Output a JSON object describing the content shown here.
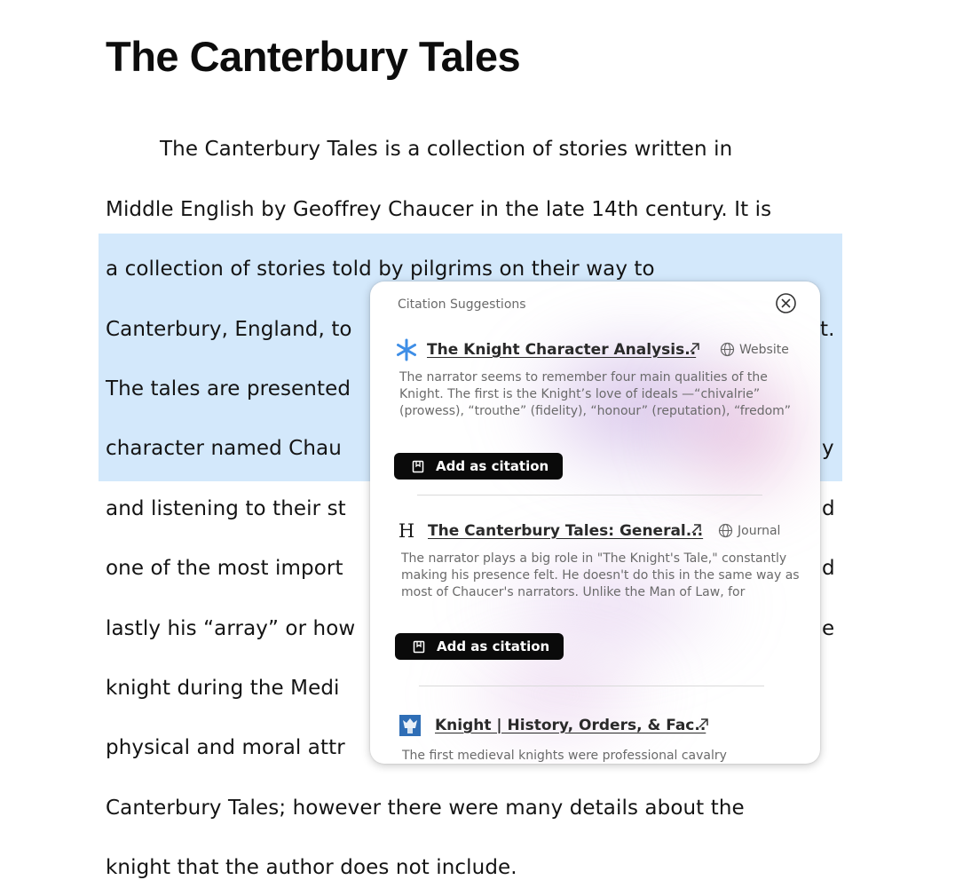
{
  "document": {
    "title": "The Canterbury Tales",
    "lines": [
      "The Canterbury Tales is a collection of stories written in",
      "Middle English by Geoffrey Chaucer in the late 14th century. It is",
      "a collection of stories told by pilgrims on their way to",
      "Canterbury, England, to",
      "The tales are presented",
      "character named Chau",
      "and listening to their st",
      "one of the most import",
      "lastly his “array” or how",
      "knight during the Medi",
      "physical and moral attr",
      "Canterbury Tales; however there were many details about the",
      "knight that the author does not include."
    ],
    "visible_tail_fragments": {
      "line4": "t.",
      "line6": "y",
      "line7": "d",
      "line8": "d",
      "line9": "e"
    }
  },
  "popup": {
    "header": "Citation Suggestions",
    "close_icon": "circle-x-icon",
    "suggestions": [
      {
        "icon": "asterisk-icon",
        "icon_color": "#3e8ee6",
        "title": "The Knight Character Analysis..",
        "external_icon": "arrow-up-right-icon",
        "type": "Website",
        "snippet": "The narrator seems to remember four main qualities of the Knight. The first is the Knight’s love of ideals —“chivalrie” (prowess), “trouthe” (fidelity), “honour” (reputation), “fredom”",
        "button_label": "Add as citation"
      },
      {
        "icon": "serif-h-icon",
        "icon_glyph": "H",
        "title": "The Canterbury Tales: General...",
        "external_icon": "arrow-up-right-icon",
        "type": "Journal",
        "snippet": "The narrator plays a big role in \"The Knight's Tale,\" constantly making his presence felt. He doesn't do this in the same way as most of Chaucer's narrators. Unlike the Man of Law, for",
        "button_label": "Add as citation"
      },
      {
        "icon": "britannica-crest-icon",
        "icon_color": "#2f6eb6",
        "title": "Knight | History, Orders, & Fac..",
        "external_icon": "arrow-up-right-icon",
        "snippet": "The first medieval knights were professional cavalry"
      }
    ]
  },
  "colors": {
    "highlight": "#d3e8fb",
    "button_bg": "#0a0a0a",
    "accent_purple": "#b28cd6"
  }
}
